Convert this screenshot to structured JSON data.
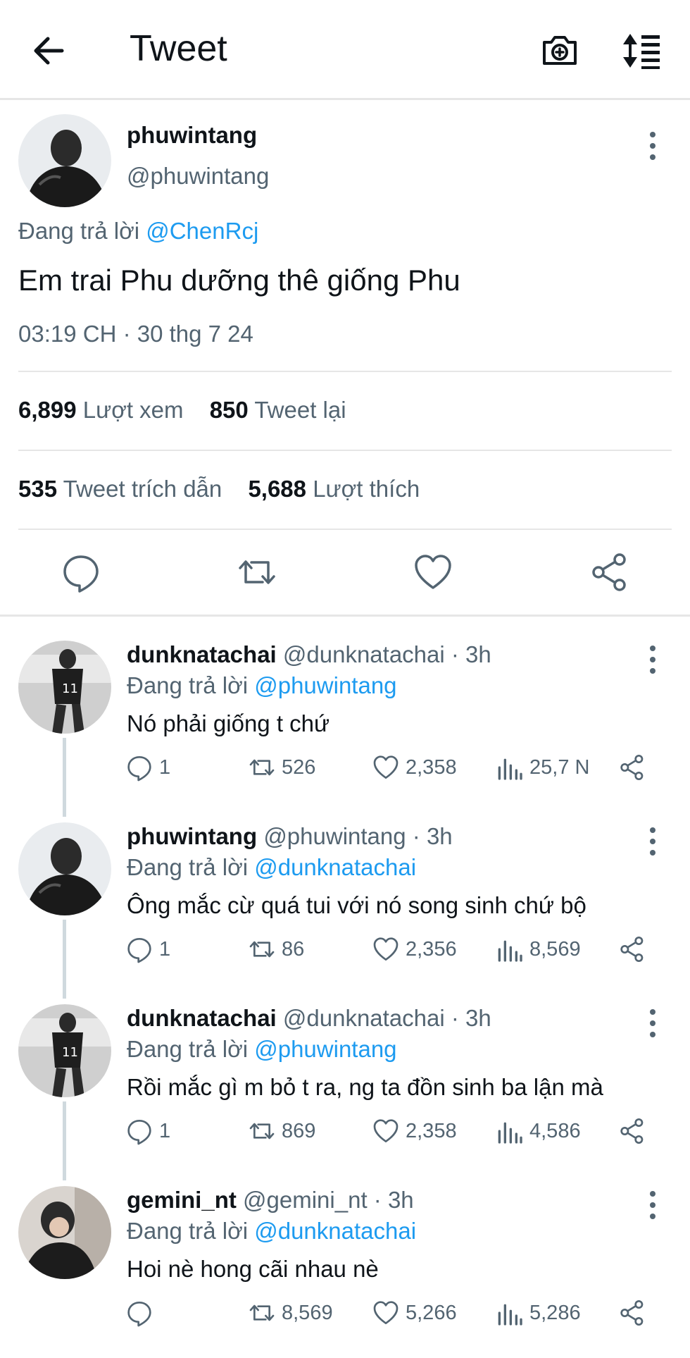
{
  "header": {
    "title": "Tweet"
  },
  "tweet": {
    "display_name": "phuwintang",
    "handle": "@phuwintang",
    "reply_prefix": "Đang trả lời",
    "reply_to": "@ChenRcj",
    "text": "Em trai Phu dưỡng thê giống Phu",
    "timestamp": "03:19 CH · 30 thg 7 24",
    "views_count": "6,899",
    "views_label": "Lượt xem",
    "retweets_count": "850",
    "retweets_label": "Tweet lại",
    "quotes_count": "535",
    "quotes_label": "Tweet trích dẫn",
    "likes_count": "5,688",
    "likes_label": "Lượt thích"
  },
  "replies": [
    {
      "display_name": "dunknatachai",
      "handle_time": "@dunknatachai · 3h",
      "reply_prefix": "Đang trả lời",
      "reply_to": "@phuwintang",
      "text": "Nó phải giống t chứ",
      "reply_count": "1",
      "retweet_count": "526",
      "like_count": "2,358",
      "view_count": "25,7 N"
    },
    {
      "display_name": "phuwintang",
      "handle_time": "@phuwintang · 3h",
      "reply_prefix": "Đang trả lời",
      "reply_to": "@dunknatachai",
      "text": "Ông mắc cừ quá tui với nó song sinh chứ bộ",
      "reply_count": "1",
      "retweet_count": "86",
      "like_count": "2,356",
      "view_count": "8,569"
    },
    {
      "display_name": "dunknatachai",
      "handle_time": "@dunknatachai · 3h",
      "reply_prefix": "Đang trả lời",
      "reply_to": "@phuwintang",
      "text": "Rồi mắc gì m bỏ t ra, ng ta đồn sinh ba lận mà",
      "reply_count": "1",
      "retweet_count": "869",
      "like_count": "2,358",
      "view_count": "4,586"
    },
    {
      "display_name": "gemini_nt",
      "handle_time": "@gemini_nt · 3h",
      "reply_prefix": "Đang trả lời",
      "reply_to": "@dunknatachai",
      "text": "Hoi nè hong cãi nhau nè",
      "reply_count": "",
      "retweet_count": "8,569",
      "like_count": "5,266",
      "view_count": "5,286"
    }
  ],
  "colors": {
    "link": "#1d9bf0",
    "secondary_text": "#536471",
    "divider": "#e6e6e6"
  },
  "icons": [
    "back-arrow-icon",
    "camera-plus-icon",
    "sort-icon",
    "more-vertical-icon",
    "reply-icon",
    "retweet-icon",
    "like-icon",
    "share-icon",
    "views-icon"
  ]
}
